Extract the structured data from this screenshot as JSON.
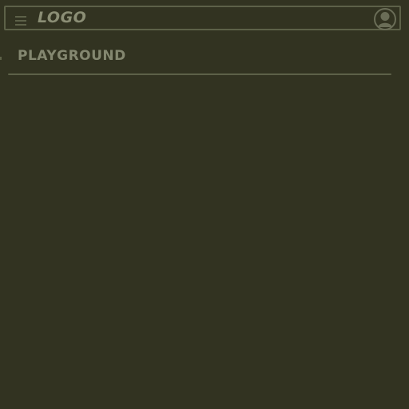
{
  "header": {
    "menu_icon": "hamburger-menu-icon",
    "logo_text": "LOGO",
    "avatar_icon": "user-avatar-icon"
  },
  "main": {
    "title": "PLAYGROUND"
  },
  "colors": {
    "background": "#323321",
    "stroke": "#5d6148",
    "text": "#8b8e75"
  }
}
